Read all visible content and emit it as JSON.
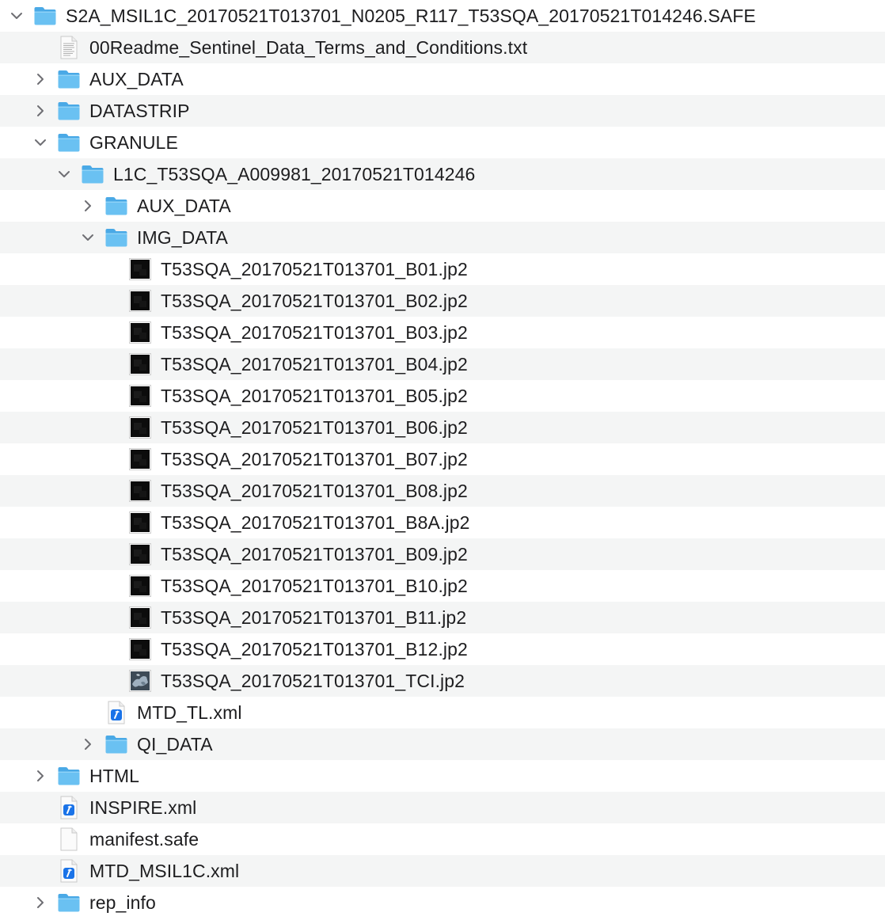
{
  "window": {
    "view": "finder-list-view"
  },
  "colors": {
    "row_alt": "#f4f5f5",
    "folder_body": "#6ac1f2",
    "folder_tab": "#4aa9e6",
    "chevron": "#6e6e73",
    "xml_badge": "#1a73e8"
  },
  "rows": [
    {
      "name": "S2A_MSIL1C_20170521T013701_N0205_R117_T53SQA_20170521T014246.SAFE",
      "depth": 0,
      "kind": "folder",
      "disclosure": "open",
      "icon": "folder-icon"
    },
    {
      "name": "00Readme_Sentinel_Data_Terms_and_Conditions.txt",
      "depth": 1,
      "kind": "text",
      "disclosure": "none",
      "icon": "text-file-icon"
    },
    {
      "name": "AUX_DATA",
      "depth": 1,
      "kind": "folder",
      "disclosure": "closed",
      "icon": "folder-icon"
    },
    {
      "name": "DATASTRIP",
      "depth": 1,
      "kind": "folder",
      "disclosure": "closed",
      "icon": "folder-icon"
    },
    {
      "name": "GRANULE",
      "depth": 1,
      "kind": "folder",
      "disclosure": "open",
      "icon": "folder-icon"
    },
    {
      "name": "L1C_T53SQA_A009981_20170521T014246",
      "depth": 2,
      "kind": "folder",
      "disclosure": "open",
      "icon": "folder-icon"
    },
    {
      "name": "AUX_DATA",
      "depth": 3,
      "kind": "folder",
      "disclosure": "closed",
      "icon": "folder-icon"
    },
    {
      "name": "IMG_DATA",
      "depth": 3,
      "kind": "folder",
      "disclosure": "open",
      "icon": "folder-icon"
    },
    {
      "name": "T53SQA_20170521T013701_B01.jp2",
      "depth": 4,
      "kind": "image",
      "disclosure": "none",
      "icon": "image-thumbnail-icon"
    },
    {
      "name": "T53SQA_20170521T013701_B02.jp2",
      "depth": 4,
      "kind": "image",
      "disclosure": "none",
      "icon": "image-thumbnail-icon"
    },
    {
      "name": "T53SQA_20170521T013701_B03.jp2",
      "depth": 4,
      "kind": "image",
      "disclosure": "none",
      "icon": "image-thumbnail-icon"
    },
    {
      "name": "T53SQA_20170521T013701_B04.jp2",
      "depth": 4,
      "kind": "image",
      "disclosure": "none",
      "icon": "image-thumbnail-icon"
    },
    {
      "name": "T53SQA_20170521T013701_B05.jp2",
      "depth": 4,
      "kind": "image",
      "disclosure": "none",
      "icon": "image-thumbnail-icon"
    },
    {
      "name": "T53SQA_20170521T013701_B06.jp2",
      "depth": 4,
      "kind": "image",
      "disclosure": "none",
      "icon": "image-thumbnail-icon"
    },
    {
      "name": "T53SQA_20170521T013701_B07.jp2",
      "depth": 4,
      "kind": "image",
      "disclosure": "none",
      "icon": "image-thumbnail-icon"
    },
    {
      "name": "T53SQA_20170521T013701_B08.jp2",
      "depth": 4,
      "kind": "image",
      "disclosure": "none",
      "icon": "image-thumbnail-icon"
    },
    {
      "name": "T53SQA_20170521T013701_B8A.jp2",
      "depth": 4,
      "kind": "image",
      "disclosure": "none",
      "icon": "image-thumbnail-icon"
    },
    {
      "name": "T53SQA_20170521T013701_B09.jp2",
      "depth": 4,
      "kind": "image",
      "disclosure": "none",
      "icon": "image-thumbnail-icon"
    },
    {
      "name": "T53SQA_20170521T013701_B10.jp2",
      "depth": 4,
      "kind": "image",
      "disclosure": "none",
      "icon": "image-thumbnail-icon"
    },
    {
      "name": "T53SQA_20170521T013701_B11.jp2",
      "depth": 4,
      "kind": "image",
      "disclosure": "none",
      "icon": "image-thumbnail-icon"
    },
    {
      "name": "T53SQA_20170521T013701_B12.jp2",
      "depth": 4,
      "kind": "image",
      "disclosure": "none",
      "icon": "image-thumbnail-icon"
    },
    {
      "name": "T53SQA_20170521T013701_TCI.jp2",
      "depth": 4,
      "kind": "image-color",
      "disclosure": "none",
      "icon": "color-image-thumbnail-icon"
    },
    {
      "name": "MTD_TL.xml",
      "depth": 3,
      "kind": "xml",
      "disclosure": "none",
      "icon": "xml-file-icon"
    },
    {
      "name": "QI_DATA",
      "depth": 3,
      "kind": "folder",
      "disclosure": "closed",
      "icon": "folder-icon"
    },
    {
      "name": "HTML",
      "depth": 1,
      "kind": "folder",
      "disclosure": "closed",
      "icon": "folder-icon"
    },
    {
      "name": "INSPIRE.xml",
      "depth": 1,
      "kind": "xml",
      "disclosure": "none",
      "icon": "xml-file-icon"
    },
    {
      "name": "manifest.safe",
      "depth": 1,
      "kind": "blank",
      "disclosure": "none",
      "icon": "blank-file-icon"
    },
    {
      "name": "MTD_MSIL1C.xml",
      "depth": 1,
      "kind": "xml",
      "disclosure": "none",
      "icon": "xml-file-icon"
    },
    {
      "name": "rep_info",
      "depth": 1,
      "kind": "folder",
      "disclosure": "closed",
      "icon": "folder-icon"
    }
  ]
}
